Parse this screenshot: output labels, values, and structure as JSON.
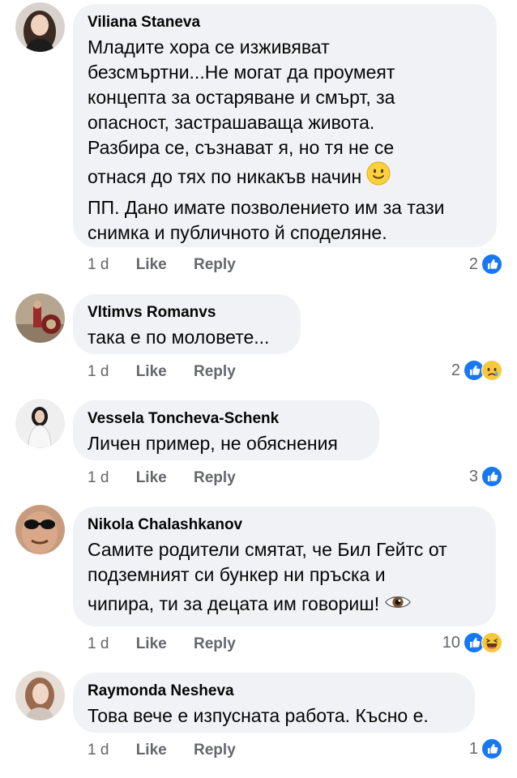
{
  "comments": [
    {
      "author": "Viliana Staneva",
      "lines": [
        "Младите хора се изживяват",
        "безсмъртни...Не могат да проумеят",
        "концепта за остаряване и смърт, за",
        "опасност, застрашаваща живота.",
        "Разбира се, съзнават я, но тя не се",
        "отнася до тях по никакъв начин",
        "ПП. Дано имате позволението им за тази",
        "снимка и публичното й споделяне."
      ],
      "time": "1 d",
      "like": "Like",
      "reply": "Reply",
      "reaction_count": "2",
      "reactions": [
        "like-icon"
      ],
      "inline_emoji": "slight-smile-emoji"
    },
    {
      "author": "Vltimvs Romanvs",
      "lines": [
        "така е по моловете..."
      ],
      "time": "1 d",
      "like": "Like",
      "reply": "Reply",
      "reaction_count": "2",
      "reactions": [
        "like-icon",
        "sad-icon"
      ]
    },
    {
      "author": "Vessela Toncheva-Schenk",
      "lines": [
        "Личен пример, не обяснения"
      ],
      "time": "1 d",
      "like": "Like",
      "reply": "Reply",
      "reaction_count": "3",
      "reactions": [
        "like-icon"
      ]
    },
    {
      "author": "Nikola Chalashkanov",
      "lines": [
        "Самите родители смятат, че Бил Гейтс от",
        "подземният си бункер ни пръска и",
        "чипира, ти за децата им говориш!"
      ],
      "time": "1 d",
      "like": "Like",
      "reply": "Reply",
      "reaction_count": "10",
      "reactions": [
        "like-icon",
        "haha-icon"
      ],
      "inline_emoji": "eye-emoji"
    },
    {
      "author": "Raymonda Nesheva",
      "lines": [
        "Това вече е изпусната работа. Късно е."
      ],
      "time": "1 d",
      "like": "Like",
      "reply": "Reply",
      "reaction_count": "1",
      "reactions": [
        "like-icon"
      ]
    }
  ],
  "colors": {
    "bubble": "#f0f2f5",
    "action_text": "#65676b",
    "like_blue": "#1877f2"
  }
}
